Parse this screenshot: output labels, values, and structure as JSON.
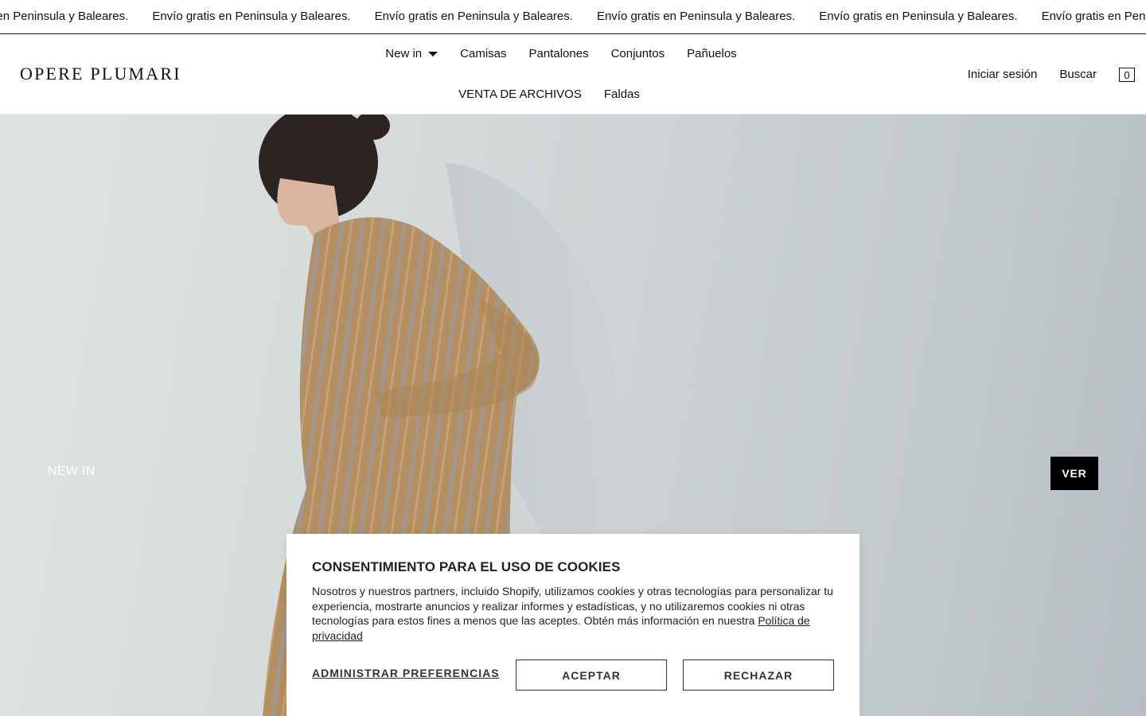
{
  "announcement": {
    "items": [
      "Envío gratis en Peninsula y Baleares.",
      "Envío gratis en Peninsula y Baleares.",
      "Envío gratis en Peninsula y Baleares.",
      "Envío gratis en Peninsula y Baleares.",
      "Envío gratis en Peninsula y Baleares.",
      "Envío gratis en Peninsula y Baleares."
    ]
  },
  "header": {
    "logo": "OPERE PLUMARI",
    "nav_row1": [
      "New in",
      "Camisas",
      "Pantalones",
      "Conjuntos",
      "Pañuelos"
    ],
    "nav_row2": [
      "VENTA DE ARCHIVOS",
      "Faldas"
    ],
    "login": "Iniciar sesión",
    "search": "Buscar",
    "cart_count": "0"
  },
  "hero": {
    "label": "NEW IN",
    "button": "VER"
  },
  "cookie": {
    "title": "CONSENTIMIENTO PARA EL USO DE COOKIES",
    "body": "Nosotros y nuestros partners, incluido Shopify, utilizamos cookies y otras tecnologías para personalizar tu experiencia, mostrarte anuncios y realizar informes y estadísticas, y no utilizaremos cookies ni otras tecnologías para estos fines a menos que las aceptes. Obtén más información en nuestra ",
    "link": "Política de privacidad",
    "prefs": "ADMINISTRAR PREFERENCIAS",
    "accept": "ACEPTAR",
    "reject": "RECHAZAR"
  }
}
